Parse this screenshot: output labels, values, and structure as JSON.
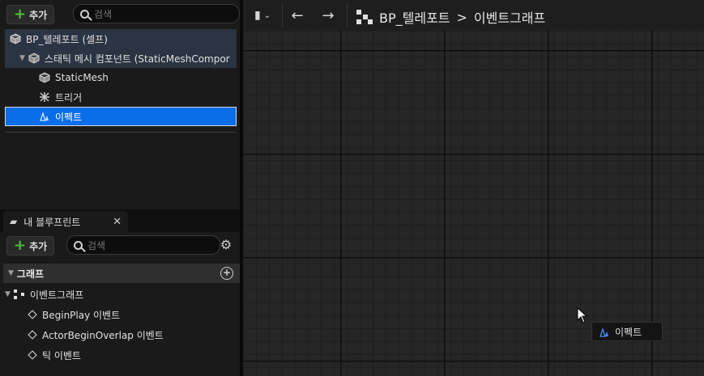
{
  "components_panel": {
    "add_label": "추가",
    "search_placeholder": "검색",
    "tree": [
      {
        "label": "BP_텔레포트 (셀프)",
        "icon": "blueprint-cube-icon",
        "level": 0
      },
      {
        "label": "스태틱 메시 컴포넌트 (StaticMeshCompor",
        "icon": "static-mesh-icon",
        "level": 1
      },
      {
        "label": "StaticMesh",
        "icon": "static-mesh-icon",
        "level": 2
      },
      {
        "label": "트리거",
        "icon": "trigger-icon",
        "level": 2
      },
      {
        "label": "이펙트",
        "icon": "particle-effect-icon",
        "level": 2,
        "selected": true
      }
    ]
  },
  "my_blueprint": {
    "tab_label": "내 블루프린트",
    "add_label": "추가",
    "search_placeholder": "검색",
    "graph_section": "그래프",
    "event_graph": "이벤트그래프",
    "events": [
      "BeginPlay 이벤트",
      "ActorBeginOverlap 이벤트",
      "틱 이벤트"
    ]
  },
  "graph_toolbar": {
    "breadcrumb_blueprint": "BP_텔레포트",
    "breadcrumb_separator": ">",
    "breadcrumb_graph": "이벤트그래프"
  },
  "drag_tooltip": {
    "label": "이펙트",
    "icon": "particle-effect-icon"
  },
  "colors": {
    "selection": "#0a6ee8",
    "add_plus": "#4fbf3a"
  }
}
